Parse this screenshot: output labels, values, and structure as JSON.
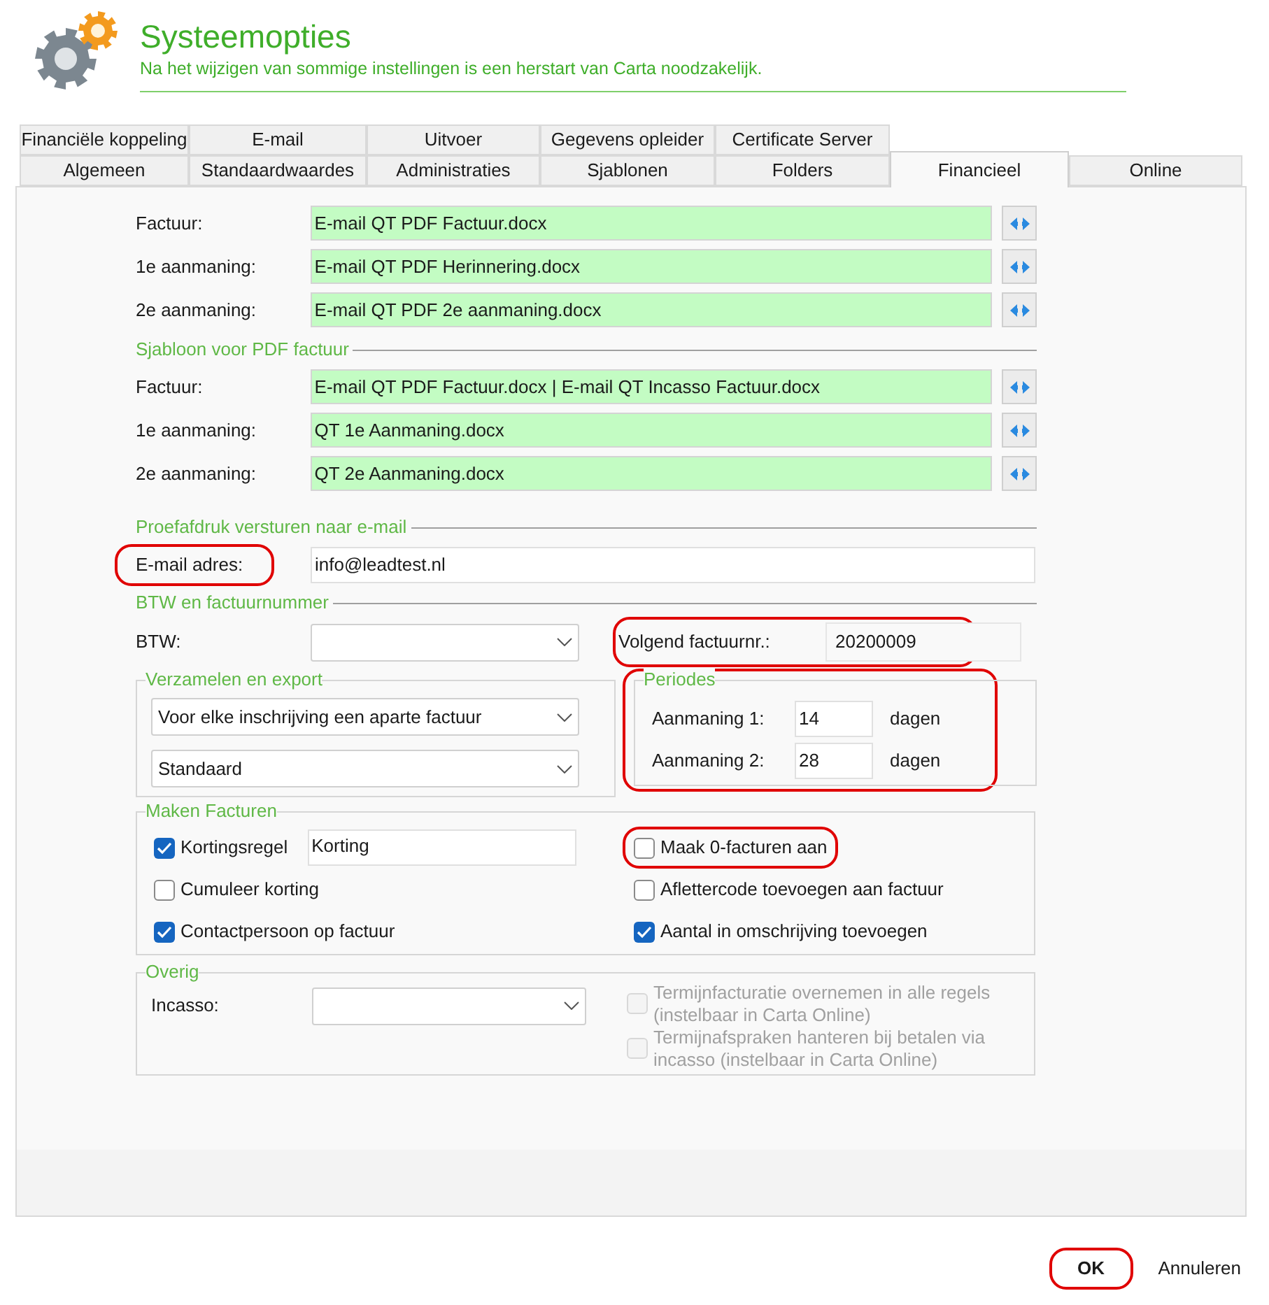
{
  "header": {
    "title": "Systeemopties",
    "subtitle": "Na het wijzigen van sommige instellingen is een herstart van Carta noodzakelijk."
  },
  "tab_rows": [
    [
      {
        "label": "Financiële koppeling",
        "selected": false
      },
      {
        "label": "E-mail",
        "selected": false
      },
      {
        "label": "Uitvoer",
        "selected": false
      },
      {
        "label": "Gegevens opleider",
        "selected": false
      },
      {
        "label": "Certificate Server",
        "selected": false
      }
    ],
    [
      {
        "label": "Algemeen",
        "selected": false
      },
      {
        "label": "Standaardwaardes",
        "selected": false
      },
      {
        "label": "Administraties",
        "selected": false
      },
      {
        "label": "Sjablonen",
        "selected": false
      },
      {
        "label": "Folders",
        "selected": false
      },
      {
        "label": "Financieel",
        "selected": true
      },
      {
        "label": "Online",
        "selected": false
      }
    ]
  ],
  "email_templates": [
    {
      "label": "Factuur:",
      "value": "E-mail QT PDF Factuur.docx"
    },
    {
      "label": "1e aanmaning:",
      "value": "E-mail QT PDF Herinnering.docx"
    },
    {
      "label": "2e aanmaning:",
      "value": "E-mail QT PDF 2e aanmaning.docx"
    }
  ],
  "pdf_templates": {
    "heading": "Sjabloon voor PDF factuur",
    "rows": [
      {
        "label": "Factuur:",
        "value": "E-mail QT PDF Factuur.docx | E-mail QT Incasso Factuur.docx"
      },
      {
        "label": "1e aanmaning:",
        "value": "QT 1e Aanmaning.docx"
      },
      {
        "label": "2e aanmaning:",
        "value": "QT 2e Aanmaning.docx"
      }
    ]
  },
  "proof": {
    "heading": "Proefafdruk versturen naar e-mail",
    "label": "E-mail adres:",
    "value": "info@leadtest.nl",
    "highlighted": true
  },
  "btw": {
    "heading": "BTW en factuurnummer",
    "btw_label": "BTW:",
    "invoice_label": "Volgend factuurnr.:",
    "invoice_value": "20200009",
    "highlighted": true
  },
  "collect": {
    "heading": "Verzamelen en export",
    "dropdowns": [
      "Voor elke inschrijving een aparte factuur",
      "Standaard"
    ]
  },
  "periods": {
    "heading": "Periodes",
    "highlighted": true,
    "rows": [
      {
        "label": "Aanmaning 1:",
        "value": "14",
        "unit": "dagen"
      },
      {
        "label": "Aanmaning 2:",
        "value": "28",
        "unit": "dagen"
      }
    ]
  },
  "invoices": {
    "heading": "Maken Facturen",
    "options": [
      {
        "label": "Kortingsregel",
        "checked": true,
        "highlighted": false,
        "field": "Korting"
      },
      {
        "label": "Maak 0-facturen aan",
        "checked": false,
        "highlighted": true
      },
      {
        "label": "Cumuleer korting",
        "checked": false,
        "highlighted": false
      },
      {
        "label": "Aflettercode toevoegen aan factuur",
        "checked": false,
        "highlighted": false
      },
      {
        "label": "Contactpersoon op factuur",
        "checked": true,
        "highlighted": false
      },
      {
        "label": "Aantal in omschrijving toevoegen",
        "checked": true,
        "highlighted": false
      }
    ]
  },
  "other": {
    "heading": "Overig",
    "incasso_label": "Incasso:",
    "options": [
      {
        "label": "Termijnfacturatie overnemen in alle regels (instelbaar in Carta Online)",
        "checked": false,
        "disabled": true
      },
      {
        "label": "Termijnafspraken hanteren bij betalen via incasso (instelbaar in Carta Online)",
        "checked": false,
        "disabled": true
      }
    ]
  },
  "buttons": [
    {
      "label": "OK",
      "highlighted": true,
      "kind": "default"
    },
    {
      "label": "Annuleren",
      "highlighted": false,
      "kind": "plain"
    }
  ]
}
